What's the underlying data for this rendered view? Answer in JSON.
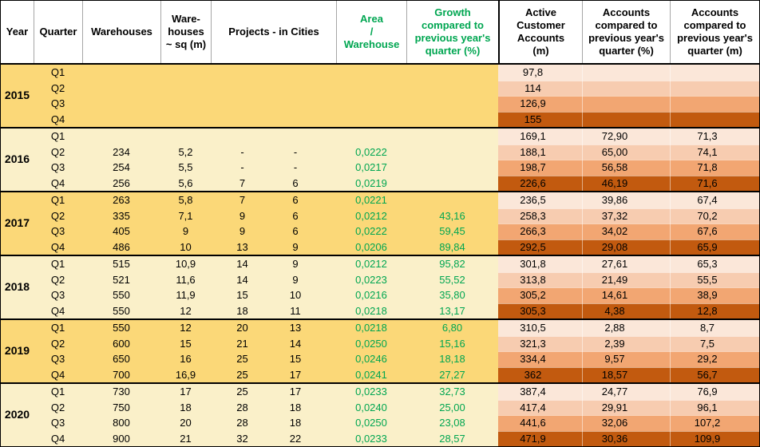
{
  "colors": {
    "group_gold": "#FBD878",
    "group_cream": "#FAF0C9",
    "green_text": "#00A651",
    "quarter_shades": [
      "#FBE7D9",
      "#F7CCB0",
      "#F2A672",
      "#C25A0F"
    ],
    "header_divider": "#A6A6A6",
    "border": "#000000"
  },
  "header": {
    "year": "Year",
    "quarter": "Quarter",
    "warehouses": "Warehouses",
    "warehouses_sqm": "Ware-\nhouses\n~ sq (m)",
    "projects": "Projects - in Cities",
    "area": "Area\n/\nWarehouse",
    "growth": "Growth\ncompared to\nprevious year's\nquarter (%)",
    "active": "Active\nCustomer\nAccounts\n(m)",
    "acc_pct": "Accounts\ncompared to\nprevious year's\nquarter (%)",
    "acc_m": "Accounts\ncompared to\nprevious year's\nquarter (m)"
  },
  "chart_data": {
    "type": "table",
    "title": "Warehouses, projects and active customer accounts by quarter, 2015-2020",
    "columns": [
      "Year",
      "Quarter",
      "Warehouses",
      "Warehouses ~ sq (m)",
      "Projects",
      "in Cities",
      "Area / Warehouse",
      "Growth compared to previous year's quarter (%)",
      "Active Customer Accounts (m)",
      "Accounts compared to previous year's quarter (%)",
      "Accounts compared to previous year's quarter (m)"
    ],
    "rows": [
      [
        "2015",
        "Q1",
        "",
        "",
        "",
        "",
        "",
        "",
        "97,8",
        "",
        ""
      ],
      [
        "2015",
        "Q2",
        "",
        "",
        "",
        "",
        "",
        "",
        "114",
        "",
        ""
      ],
      [
        "2015",
        "Q3",
        "",
        "",
        "",
        "",
        "",
        "",
        "126,9",
        "",
        ""
      ],
      [
        "2015",
        "Q4",
        "",
        "",
        "",
        "",
        "",
        "",
        "155",
        "",
        ""
      ],
      [
        "2016",
        "Q1",
        "",
        "",
        "",
        "",
        "",
        "",
        "169,1",
        "72,90",
        "71,3"
      ],
      [
        "2016",
        "Q2",
        "234",
        "5,2",
        "-",
        "-",
        "0,0222",
        "",
        "188,1",
        "65,00",
        "74,1"
      ],
      [
        "2016",
        "Q3",
        "254",
        "5,5",
        "-",
        "-",
        "0,0217",
        "",
        "198,7",
        "56,58",
        "71,8"
      ],
      [
        "2016",
        "Q4",
        "256",
        "5,6",
        "7",
        "6",
        "0,0219",
        "",
        "226,6",
        "46,19",
        "71,6"
      ],
      [
        "2017",
        "Q1",
        "263",
        "5,8",
        "7",
        "6",
        "0,0221",
        "",
        "236,5",
        "39,86",
        "67,4"
      ],
      [
        "2017",
        "Q2",
        "335",
        "7,1",
        "9",
        "6",
        "0,0212",
        "43,16",
        "258,3",
        "37,32",
        "70,2"
      ],
      [
        "2017",
        "Q3",
        "405",
        "9",
        "9",
        "6",
        "0,0222",
        "59,45",
        "266,3",
        "34,02",
        "67,6"
      ],
      [
        "2017",
        "Q4",
        "486",
        "10",
        "13",
        "9",
        "0,0206",
        "89,84",
        "292,5",
        "29,08",
        "65,9"
      ],
      [
        "2018",
        "Q1",
        "515",
        "10,9",
        "14",
        "9",
        "0,0212",
        "95,82",
        "301,8",
        "27,61",
        "65,3"
      ],
      [
        "2018",
        "Q2",
        "521",
        "11,6",
        "14",
        "9",
        "0,0223",
        "55,52",
        "313,8",
        "21,49",
        "55,5"
      ],
      [
        "2018",
        "Q3",
        "550",
        "11,9",
        "15",
        "10",
        "0,0216",
        "35,80",
        "305,2",
        "14,61",
        "38,9"
      ],
      [
        "2018",
        "Q4",
        "550",
        "12",
        "18",
        "11",
        "0,0218",
        "13,17",
        "305,3",
        "4,38",
        "12,8"
      ],
      [
        "2019",
        "Q1",
        "550",
        "12",
        "20",
        "13",
        "0,0218",
        "6,80",
        "310,5",
        "2,88",
        "8,7"
      ],
      [
        "2019",
        "Q2",
        "600",
        "15",
        "21",
        "14",
        "0,0250",
        "15,16",
        "321,3",
        "2,39",
        "7,5"
      ],
      [
        "2019",
        "Q3",
        "650",
        "16",
        "25",
        "15",
        "0,0246",
        "18,18",
        "334,4",
        "9,57",
        "29,2"
      ],
      [
        "2019",
        "Q4",
        "700",
        "16,9",
        "25",
        "17",
        "0,0241",
        "27,27",
        "362",
        "18,57",
        "56,7"
      ],
      [
        "2020",
        "Q1",
        "730",
        "17",
        "25",
        "17",
        "0,0233",
        "32,73",
        "387,4",
        "24,77",
        "76,9"
      ],
      [
        "2020",
        "Q2",
        "750",
        "18",
        "28",
        "18",
        "0,0240",
        "25,00",
        "417,4",
        "29,91",
        "96,1"
      ],
      [
        "2020",
        "Q3",
        "800",
        "20",
        "28",
        "18",
        "0,0250",
        "23,08",
        "441,6",
        "32,06",
        "107,2"
      ],
      [
        "2020",
        "Q4",
        "900",
        "21",
        "32",
        "22",
        "0,0233",
        "28,57",
        "471,9",
        "30,36",
        "109,9"
      ]
    ]
  }
}
